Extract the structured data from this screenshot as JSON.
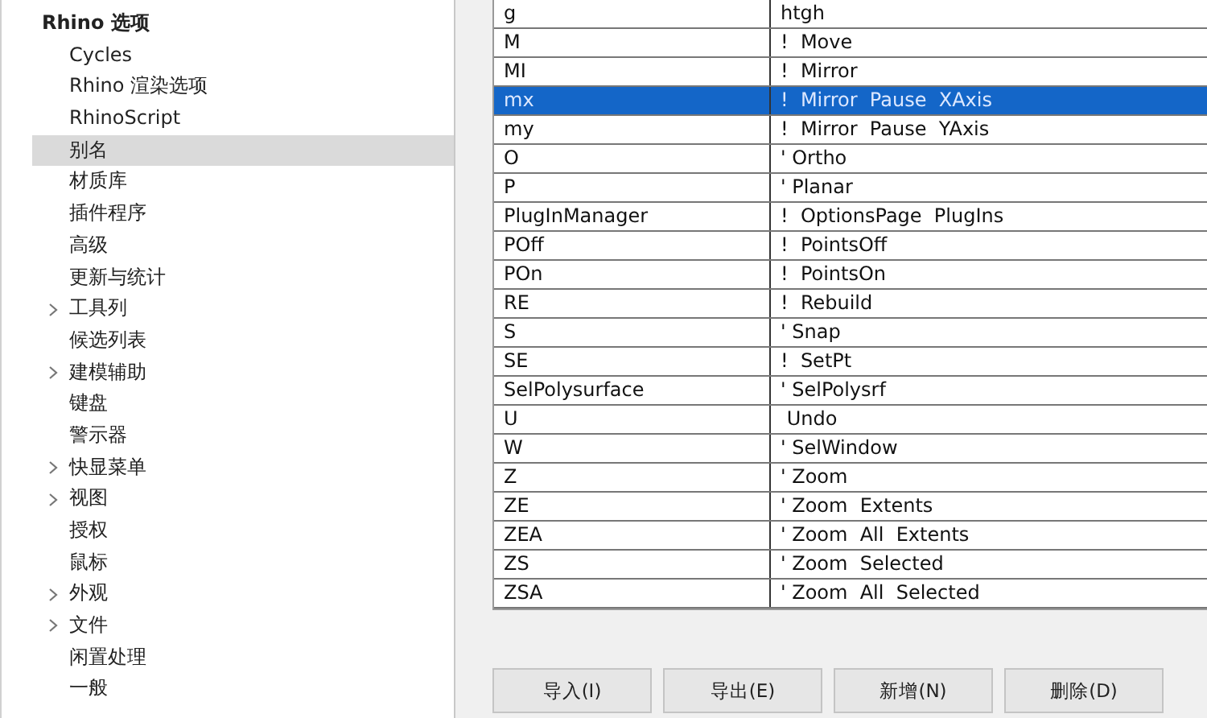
{
  "sidebar": {
    "root": {
      "label": "Rhino 选项",
      "children": [
        {
          "label": "Cycles",
          "expandable": false,
          "selected": false
        },
        {
          "label": "Rhino 渲染选项",
          "expandable": false,
          "selected": false
        },
        {
          "label": "RhinoScript",
          "expandable": false,
          "selected": false
        },
        {
          "label": "别名",
          "expandable": false,
          "selected": true
        },
        {
          "label": "材质库",
          "expandable": false,
          "selected": false
        },
        {
          "label": "插件程序",
          "expandable": false,
          "selected": false
        },
        {
          "label": "高级",
          "expandable": false,
          "selected": false
        },
        {
          "label": "更新与统计",
          "expandable": false,
          "selected": false
        },
        {
          "label": "工具列",
          "expandable": true,
          "selected": false
        },
        {
          "label": "候选列表",
          "expandable": false,
          "selected": false
        },
        {
          "label": "建模辅助",
          "expandable": true,
          "selected": false
        },
        {
          "label": "键盘",
          "expandable": false,
          "selected": false
        },
        {
          "label": "警示器",
          "expandable": false,
          "selected": false
        },
        {
          "label": "快显菜单",
          "expandable": true,
          "selected": false
        },
        {
          "label": "视图",
          "expandable": true,
          "selected": false
        },
        {
          "label": "授权",
          "expandable": false,
          "selected": false
        },
        {
          "label": "鼠标",
          "expandable": false,
          "selected": false
        },
        {
          "label": "外观",
          "expandable": true,
          "selected": false
        },
        {
          "label": "文件",
          "expandable": true,
          "selected": false
        },
        {
          "label": "闲置处理",
          "expandable": false,
          "selected": false
        },
        {
          "label": "一般",
          "expandable": false,
          "selected": false
        }
      ]
    }
  },
  "aliases": {
    "rows": [
      {
        "alias": "g",
        "macro": "htgh",
        "selected": false
      },
      {
        "alias": "M",
        "macro": "!  Move",
        "selected": false
      },
      {
        "alias": "MI",
        "macro": "!  Mirror",
        "selected": false
      },
      {
        "alias": "mx",
        "macro": "!  Mirror  Pause  XAxis",
        "selected": true
      },
      {
        "alias": "my",
        "macro": "!  Mirror  Pause  YAxis",
        "selected": false
      },
      {
        "alias": "O",
        "macro": "' Ortho",
        "selected": false
      },
      {
        "alias": "P",
        "macro": "' Planar",
        "selected": false
      },
      {
        "alias": "PlugInManager",
        "macro": "!  OptionsPage  PlugIns",
        "selected": false
      },
      {
        "alias": "POff",
        "macro": "!  PointsOff",
        "selected": false
      },
      {
        "alias": "POn",
        "macro": "!  PointsOn",
        "selected": false
      },
      {
        "alias": "RE",
        "macro": "!  Rebuild",
        "selected": false
      },
      {
        "alias": "S",
        "macro": "' Snap",
        "selected": false
      },
      {
        "alias": "SE",
        "macro": "!  SetPt",
        "selected": false
      },
      {
        "alias": "SelPolysurface",
        "macro": "' SelPolysrf",
        "selected": false
      },
      {
        "alias": "U",
        "macro": " Undo",
        "selected": false
      },
      {
        "alias": "W",
        "macro": "' SelWindow",
        "selected": false
      },
      {
        "alias": "Z",
        "macro": "' Zoom",
        "selected": false
      },
      {
        "alias": "ZE",
        "macro": "' Zoom  Extents",
        "selected": false
      },
      {
        "alias": "ZEA",
        "macro": "' Zoom  All  Extents",
        "selected": false
      },
      {
        "alias": "ZS",
        "macro": "' Zoom  Selected",
        "selected": false
      },
      {
        "alias": "ZSA",
        "macro": "' Zoom  All  Selected",
        "selected": false
      }
    ]
  },
  "buttons": [
    "导入(I)",
    "导出(E)",
    "新增(N)",
    "删除(D)"
  ]
}
